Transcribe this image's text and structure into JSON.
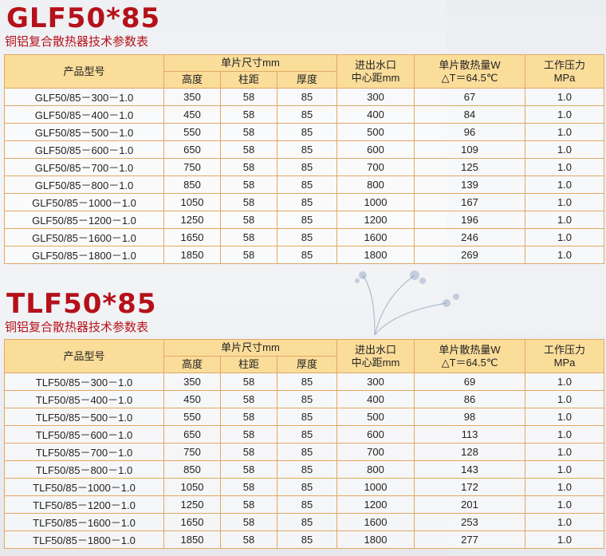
{
  "columns": {
    "model": "产品型号",
    "size_group": "单片尺寸mm",
    "height": "高度",
    "spacing": "柱距",
    "thickness": "厚度",
    "inlet_line1": "进出水口",
    "inlet_line2": "中心距mm",
    "heat_line1": "单片散热量W",
    "heat_line2": "△T＝64.5℃",
    "pressure_line1": "工作压力",
    "pressure_line2": "MPa"
  },
  "tables": [
    {
      "title": "GLF50*85",
      "subtitle": "铜铝复合散热器技术参数表",
      "rows": [
        {
          "model": "GLF50/85－300－1.0",
          "height": "350",
          "spacing": "58",
          "thickness": "85",
          "inlet": "300",
          "heat": "67",
          "pressure": "1.0"
        },
        {
          "model": "GLF50/85－400－1.0",
          "height": "450",
          "spacing": "58",
          "thickness": "85",
          "inlet": "400",
          "heat": "84",
          "pressure": "1.0"
        },
        {
          "model": "GLF50/85－500－1.0",
          "height": "550",
          "spacing": "58",
          "thickness": "85",
          "inlet": "500",
          "heat": "96",
          "pressure": "1.0"
        },
        {
          "model": "GLF50/85－600－1.0",
          "height": "650",
          "spacing": "58",
          "thickness": "85",
          "inlet": "600",
          "heat": "109",
          "pressure": "1.0"
        },
        {
          "model": "GLF50/85－700－1.0",
          "height": "750",
          "spacing": "58",
          "thickness": "85",
          "inlet": "700",
          "heat": "125",
          "pressure": "1.0"
        },
        {
          "model": "GLF50/85－800－1.0",
          "height": "850",
          "spacing": "58",
          "thickness": "85",
          "inlet": "800",
          "heat": "139",
          "pressure": "1.0"
        },
        {
          "model": "GLF50/85－1000－1.0",
          "height": "1050",
          "spacing": "58",
          "thickness": "85",
          "inlet": "1000",
          "heat": "167",
          "pressure": "1.0"
        },
        {
          "model": "GLF50/85－1200－1.0",
          "height": "1250",
          "spacing": "58",
          "thickness": "85",
          "inlet": "1200",
          "heat": "196",
          "pressure": "1.0"
        },
        {
          "model": "GLF50/85－1600－1.0",
          "height": "1650",
          "spacing": "58",
          "thickness": "85",
          "inlet": "1600",
          "heat": "246",
          "pressure": "1.0"
        },
        {
          "model": "GLF50/85－1800－1.0",
          "height": "1850",
          "spacing": "58",
          "thickness": "85",
          "inlet": "1800",
          "heat": "269",
          "pressure": "1.0"
        }
      ]
    },
    {
      "title": "TLF50*85",
      "subtitle": "铜铝复合散热器技术参数表",
      "rows": [
        {
          "model": "TLF50/85－300－1.0",
          "height": "350",
          "spacing": "58",
          "thickness": "85",
          "inlet": "300",
          "heat": "69",
          "pressure": "1.0"
        },
        {
          "model": "TLF50/85－400－1.0",
          "height": "450",
          "spacing": "58",
          "thickness": "85",
          "inlet": "400",
          "heat": "86",
          "pressure": "1.0"
        },
        {
          "model": "TLF50/85－500－1.0",
          "height": "550",
          "spacing": "58",
          "thickness": "85",
          "inlet": "500",
          "heat": "98",
          "pressure": "1.0"
        },
        {
          "model": "TLF50/85－600－1.0",
          "height": "650",
          "spacing": "58",
          "thickness": "85",
          "inlet": "600",
          "heat": "113",
          "pressure": "1.0"
        },
        {
          "model": "TLF50/85－700－1.0",
          "height": "750",
          "spacing": "58",
          "thickness": "85",
          "inlet": "700",
          "heat": "128",
          "pressure": "1.0"
        },
        {
          "model": "TLF50/85－800－1.0",
          "height": "850",
          "spacing": "58",
          "thickness": "85",
          "inlet": "800",
          "heat": "143",
          "pressure": "1.0"
        },
        {
          "model": "TLF50/85－1000－1.0",
          "height": "1050",
          "spacing": "58",
          "thickness": "85",
          "inlet": "1000",
          "heat": "172",
          "pressure": "1.0"
        },
        {
          "model": "TLF50/85－1200－1.0",
          "height": "1250",
          "spacing": "58",
          "thickness": "85",
          "inlet": "1200",
          "heat": "201",
          "pressure": "1.0"
        },
        {
          "model": "TLF50/85－1600－1.0",
          "height": "1650",
          "spacing": "58",
          "thickness": "85",
          "inlet": "1600",
          "heat": "253",
          "pressure": "1.0"
        },
        {
          "model": "TLF50/85－1800－1.0",
          "height": "1850",
          "spacing": "58",
          "thickness": "85",
          "inlet": "1800",
          "heat": "277",
          "pressure": "1.0"
        }
      ]
    }
  ]
}
